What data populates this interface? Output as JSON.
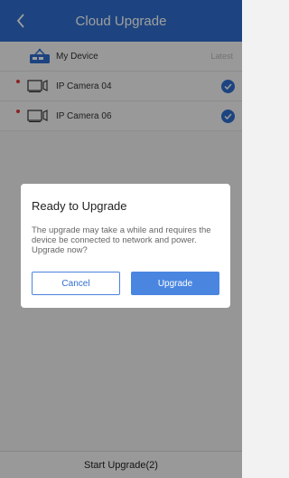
{
  "header": {
    "title": "Cloud Upgrade",
    "back_icon": "chevron-left-icon"
  },
  "devices": {
    "my_device": {
      "label": "My Device",
      "status": "Latest",
      "icon": "nvr-device-icon"
    },
    "cameras": [
      {
        "label": "IP Camera 04",
        "needs_update": true,
        "checked": true,
        "icon": "camera-icon"
      },
      {
        "label": "IP Camera 06",
        "needs_update": true,
        "checked": true,
        "icon": "camera-icon"
      }
    ]
  },
  "bottom_bar": {
    "label": "Start Upgrade(2)"
  },
  "dialog": {
    "title": "Ready to Upgrade",
    "message": "The upgrade may take a while and requires the device be connected to network and power. Upgrade now?",
    "cancel_label": "Cancel",
    "confirm_label": "Upgrade"
  },
  "colors": {
    "accent": "#2f6fcf",
    "alert_dot": "#e13b3b"
  }
}
